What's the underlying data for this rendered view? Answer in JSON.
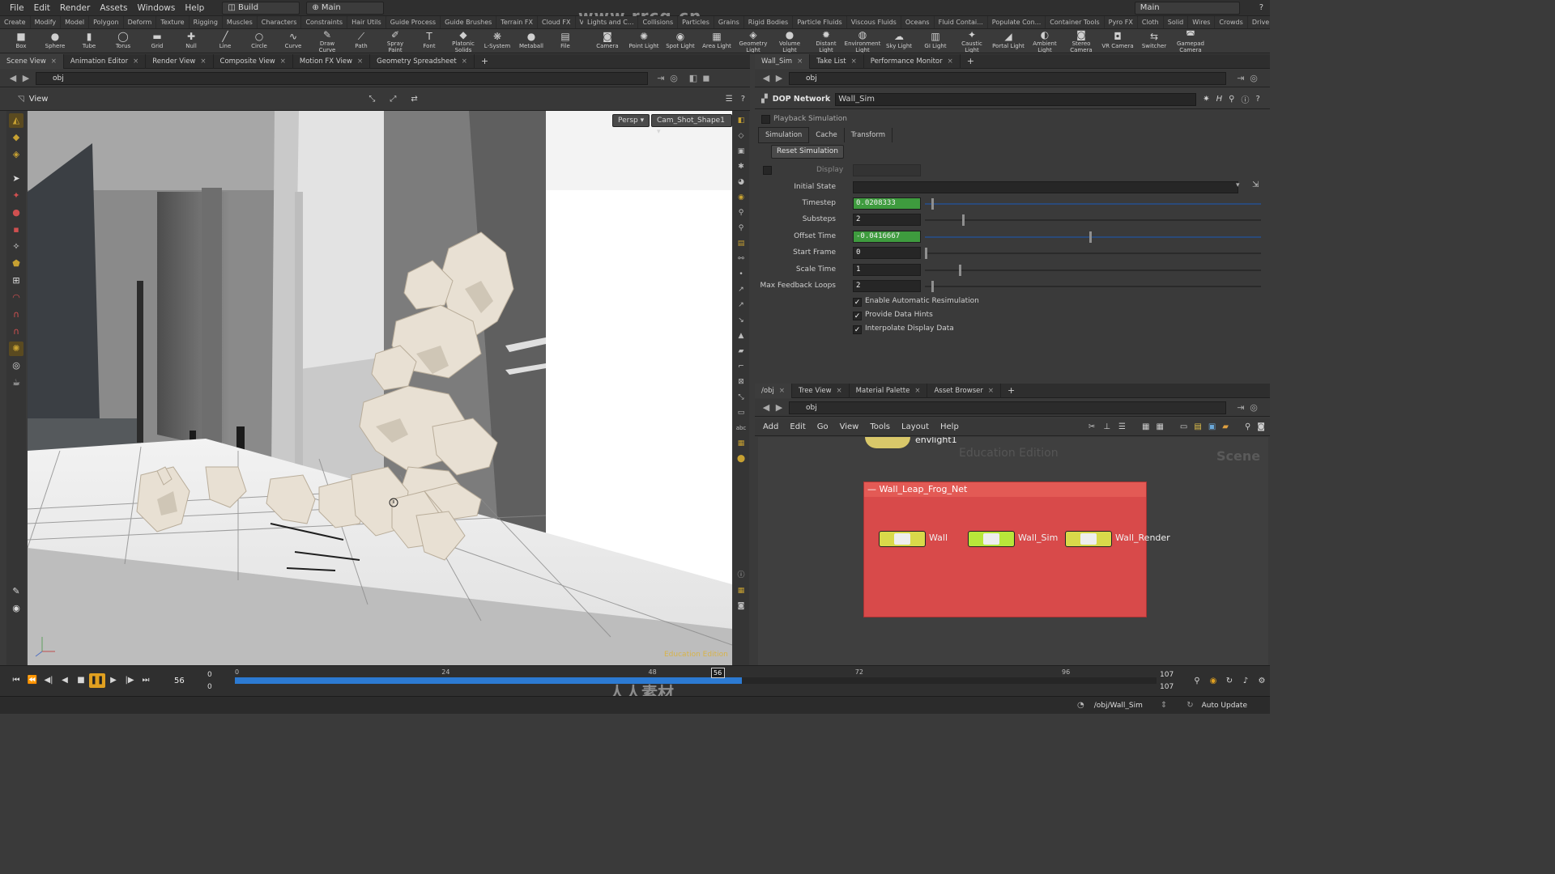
{
  "menu": [
    "File",
    "Edit",
    "Render",
    "Assets",
    "Windows",
    "Help"
  ],
  "desktop_left": "Build",
  "desktop_center": "Main",
  "desktop_right": "Main",
  "shelf_tabs_left": [
    "Create",
    "Modify",
    "Model",
    "Polygon",
    "Deform",
    "Texture",
    "Rigging",
    "Muscles",
    "Characters",
    "Constraints",
    "Hair Utils",
    "Guide Process",
    "Guide Brushes",
    "Terrain FX",
    "Cloud FX",
    "Volume"
  ],
  "shelf_tabs_right": [
    "Lights and C...",
    "Collisions",
    "Particles",
    "Grains",
    "Rigid Bodies",
    "Particle Fluids",
    "Viscous Fluids",
    "Oceans",
    "Fluid Contai...",
    "Populate Con...",
    "Container Tools",
    "Pyro FX",
    "Cloth",
    "Solid",
    "Wires",
    "Crowds",
    "Drive Simula..."
  ],
  "tools_left": [
    {
      "label": "Box",
      "icon": "box-icon",
      "glyph": "■"
    },
    {
      "label": "Sphere",
      "icon": "sphere-icon",
      "glyph": "●"
    },
    {
      "label": "Tube",
      "icon": "tube-icon",
      "glyph": "▮"
    },
    {
      "label": "Torus",
      "icon": "torus-icon",
      "glyph": "◯"
    },
    {
      "label": "Grid",
      "icon": "grid-icon",
      "glyph": "▬"
    },
    {
      "label": "Null",
      "icon": "null-icon",
      "glyph": "✚"
    },
    {
      "label": "Line",
      "icon": "line-icon",
      "glyph": "╱"
    },
    {
      "label": "Circle",
      "icon": "circle-icon",
      "glyph": "○"
    },
    {
      "label": "Curve",
      "icon": "curve-icon",
      "glyph": "∿"
    },
    {
      "label": "Draw Curve",
      "icon": "draw-curve-icon",
      "glyph": "✎"
    },
    {
      "label": "Path",
      "icon": "path-icon",
      "glyph": "⟋"
    },
    {
      "label": "Spray Paint",
      "icon": "spray-paint-icon",
      "glyph": "✐"
    },
    {
      "label": "Font",
      "icon": "font-icon",
      "glyph": "T"
    },
    {
      "label": "Platonic Solids",
      "icon": "platonic-solids-icon",
      "glyph": "◆"
    },
    {
      "label": "L-System",
      "icon": "l-system-icon",
      "glyph": "❋"
    },
    {
      "label": "Metaball",
      "icon": "metaball-icon",
      "glyph": "●"
    },
    {
      "label": "File",
      "icon": "file-icon",
      "glyph": "▤"
    }
  ],
  "tools_right": [
    {
      "label": "Camera",
      "icon": "camera-icon",
      "glyph": "◙"
    },
    {
      "label": "Point Light",
      "icon": "point-light-icon",
      "glyph": "✺"
    },
    {
      "label": "Spot Light",
      "icon": "spot-light-icon",
      "glyph": "◉"
    },
    {
      "label": "Area Light",
      "icon": "area-light-icon",
      "glyph": "▦"
    },
    {
      "label": "Geometry Light",
      "icon": "geometry-light-icon",
      "glyph": "◈"
    },
    {
      "label": "Volume Light",
      "icon": "volume-light-icon",
      "glyph": "●"
    },
    {
      "label": "Distant Light",
      "icon": "distant-light-icon",
      "glyph": "✹"
    },
    {
      "label": "Environment Light",
      "icon": "environment-light-icon",
      "glyph": "◍"
    },
    {
      "label": "Sky Light",
      "icon": "sky-light-icon",
      "glyph": "☁"
    },
    {
      "label": "GI Light",
      "icon": "gi-light-icon",
      "glyph": "▥"
    },
    {
      "label": "Caustic Light",
      "icon": "caustic-light-icon",
      "glyph": "✦"
    },
    {
      "label": "Portal Light",
      "icon": "portal-light-icon",
      "glyph": "◢"
    },
    {
      "label": "Ambient Light",
      "icon": "ambient-light-icon",
      "glyph": "◐"
    },
    {
      "label": "Stereo Camera",
      "icon": "stereo-camera-icon",
      "glyph": "◙"
    },
    {
      "label": "VR Camera",
      "icon": "vr-camera-icon",
      "glyph": "◘"
    },
    {
      "label": "Switcher",
      "icon": "switcher-icon",
      "glyph": "⇆"
    },
    {
      "label": "Gamepad Camera",
      "icon": "gamepad-camera-icon",
      "glyph": "◚"
    }
  ],
  "left_pane_tabs": [
    "Scene View",
    "Animation Editor",
    "Render View",
    "Composite View",
    "Motion FX View",
    "Geometry Spreadsheet"
  ],
  "left_path": "obj",
  "view_label": "View",
  "viewport": {
    "persp": "Persp",
    "camera": "Cam_Shot_Shape1",
    "watermark": "Education Edition"
  },
  "right_pane_tabs": [
    "Wall_Sim",
    "Take List",
    "Performance Monitor"
  ],
  "right_path": "obj",
  "param_header": {
    "type": "DOP Network",
    "name": "Wall_Sim"
  },
  "playback_simulation": "Playback Simulation",
  "param_tabs": [
    "Simulation",
    "Cache",
    "Transform"
  ],
  "reset_button": "Reset Simulation",
  "display_label": "Display",
  "params": [
    {
      "label": "Initial State",
      "value": "",
      "animated": false
    },
    {
      "label": "Timestep",
      "value": "0.0208333",
      "animated": true,
      "slider": 0.02
    },
    {
      "label": "Substeps",
      "value": "2",
      "animated": false,
      "slider": 0.11
    },
    {
      "label": "Offset Time",
      "value": "-0.0416667",
      "animated": true,
      "slider": 0.49
    },
    {
      "label": "Start Frame",
      "value": "0",
      "animated": false,
      "slider": 0.0
    },
    {
      "label": "Scale Time",
      "value": "1",
      "animated": false,
      "slider": 0.1
    },
    {
      "label": "Max Feedback Loops",
      "value": "2",
      "animated": false,
      "slider": 0.02
    }
  ],
  "checks": [
    {
      "label": "Enable Automatic Resimulation",
      "checked": true
    },
    {
      "label": "Provide Data Hints",
      "checked": true
    },
    {
      "label": "Interpolate Display Data",
      "checked": true
    }
  ],
  "net_pane_tabs": [
    "/obj",
    "Tree View",
    "Material Palette",
    "Asset Browser"
  ],
  "net_path": "obj",
  "net_menu": [
    "Add",
    "Edit",
    "Go",
    "View",
    "Tools",
    "Layout",
    "Help"
  ],
  "network": {
    "context": "Scene",
    "edition": "Education Edition",
    "light_node": "envlight1",
    "netbox_title": "Wall_Leap_Frog_Net",
    "nodes": [
      {
        "name": "Wall",
        "color": "#d9d94a"
      },
      {
        "name": "Wall_Sim",
        "color": "#b8e63a"
      },
      {
        "name": "Wall_Render",
        "color": "#d9d94a"
      }
    ]
  },
  "timeline": {
    "current_frame": "56",
    "start": "0",
    "start2": "0",
    "end": "107",
    "end2": "107",
    "ticks": [
      "0",
      "24",
      "48",
      "72",
      "96"
    ],
    "marker": "56",
    "progress": 0.55
  },
  "status": {
    "path": "/obj/Wall_Sim",
    "update": "Auto Update"
  },
  "watermark_site": "www.rrcg.cn",
  "bottom_watermark": "人人素材"
}
